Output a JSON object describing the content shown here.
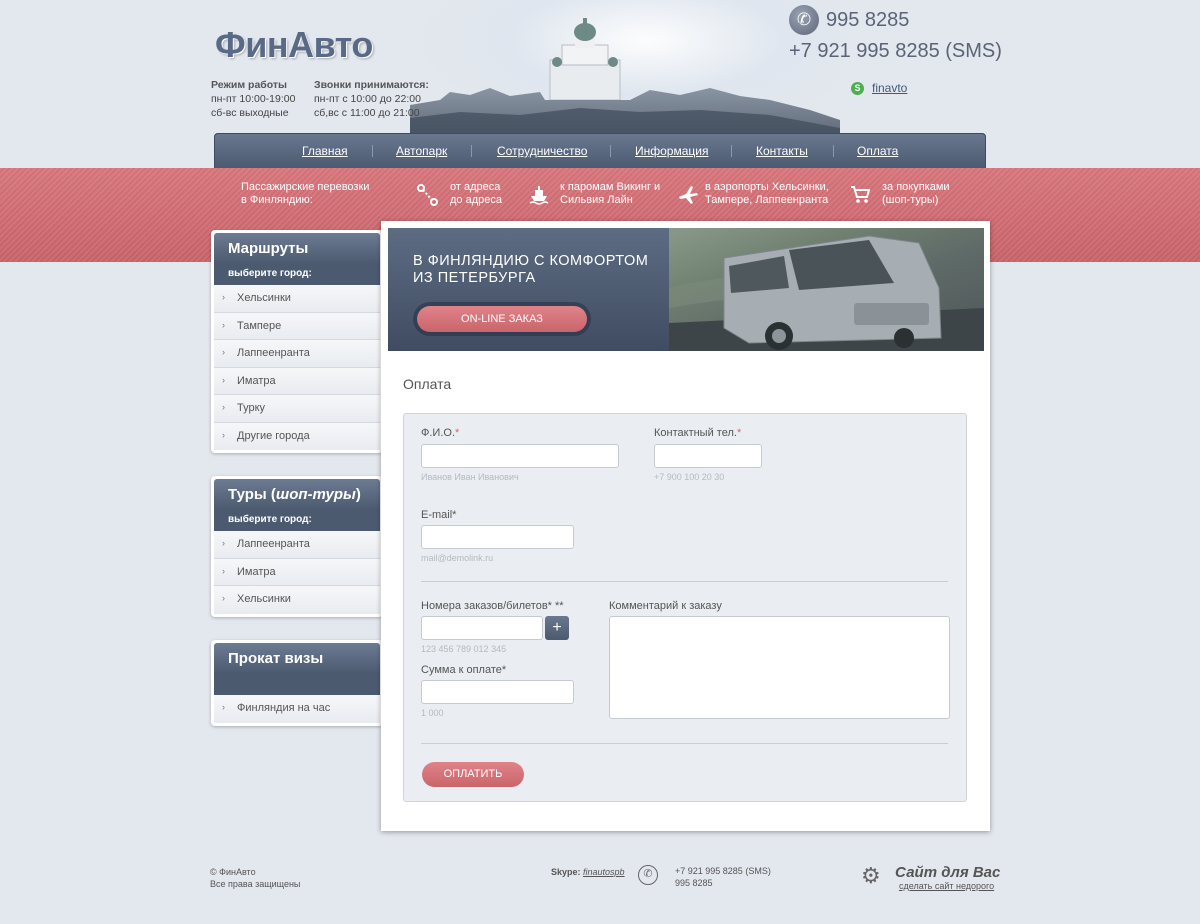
{
  "header": {
    "logo": "ФинАвто",
    "hours": {
      "title": "Режим работы",
      "line1": "пн-пт 10:00-19:00",
      "line2": "сб-вс выходные"
    },
    "calls": {
      "title": "Звонки принимаются:",
      "line1": "пн-пт с 10:00 до 22:00",
      "line2": "сб,вс с 11:00 до 21:00"
    },
    "phone_main": "995 8285",
    "phone_sms": "+7 921 995 8285 (SMS)",
    "skype": "finavto"
  },
  "nav": {
    "items": [
      "Главная",
      "Автопарк",
      "Сотрудничество",
      "Информация",
      "Контакты",
      "Оплата"
    ]
  },
  "band": {
    "intro": [
      "Пассажирские перевозки",
      "в Финляндию:"
    ],
    "services": [
      {
        "icon": "route-icon",
        "line1": "от адреса",
        "line2": "до адреса"
      },
      {
        "icon": "ferry-icon",
        "line1": "к паромам Викинг и",
        "line2": "Сильвия Лайн"
      },
      {
        "icon": "plane-icon",
        "line1": "в аэропорты Хельсинки,",
        "line2": "Тампере, Лаппеенранта"
      },
      {
        "icon": "cart-icon",
        "line1": "за покупками",
        "line2": "(шоп-туры)"
      }
    ]
  },
  "sidebar": {
    "routes": {
      "title": "Маршруты",
      "subtitle": "выберите город:",
      "items": [
        "Хельсинки",
        "Тампере",
        "Лаппеенранта",
        "Иматра",
        "Турку",
        "Другие города"
      ]
    },
    "tours": {
      "title_plain": "Туры (",
      "title_italic": "шоп-туры",
      "title_end": ")",
      "subtitle": "выберите город:",
      "items": [
        "Лаппеенранта",
        "Иматра",
        "Хельсинки"
      ]
    },
    "visa": {
      "title": "Прокат визы",
      "items": [
        "Финляндия на час"
      ]
    }
  },
  "banner": {
    "title": "В ФИНЛЯНДИЮ С КОМФОРТОМ ИЗ ПЕТЕРБУРГА",
    "button": "ON-LINE ЗАКАЗ"
  },
  "page": {
    "title": "Оплата"
  },
  "form": {
    "fio_label": "Ф.И.О.",
    "fio_hint": "Иванов Иван Иванович",
    "phone_label": "Контактный тел.",
    "phone_hint": "+7 900 100 20 30",
    "email_label": "E-mail",
    "email_hint": "mail@demolink.ru",
    "orders_label": "Номера заказов/билетов",
    "orders_req": "* **",
    "orders_hint": "123 456 789 012 345",
    "amount_label": "Сумма к оплате",
    "amount_hint": "1 000",
    "comment_label": "Комментарий к заказу",
    "req_mark": "*",
    "plus": "+",
    "pay_button": "ОПЛАТИТЬ"
  },
  "footer": {
    "copyright": "© ФинАвто",
    "rights": "Все права защищены",
    "skype_label": "Skype:",
    "skype_value": "finautospb",
    "phone_sms": "+7 921 995 8285 (SMS)",
    "phone": "995 8285",
    "brand": "Сайт для Вас",
    "brand_sub": "сделать сайт недорого"
  },
  "colors": {
    "accent": "#c9646b",
    "nav": "#4c5a70",
    "background": "#e3e7ee"
  }
}
